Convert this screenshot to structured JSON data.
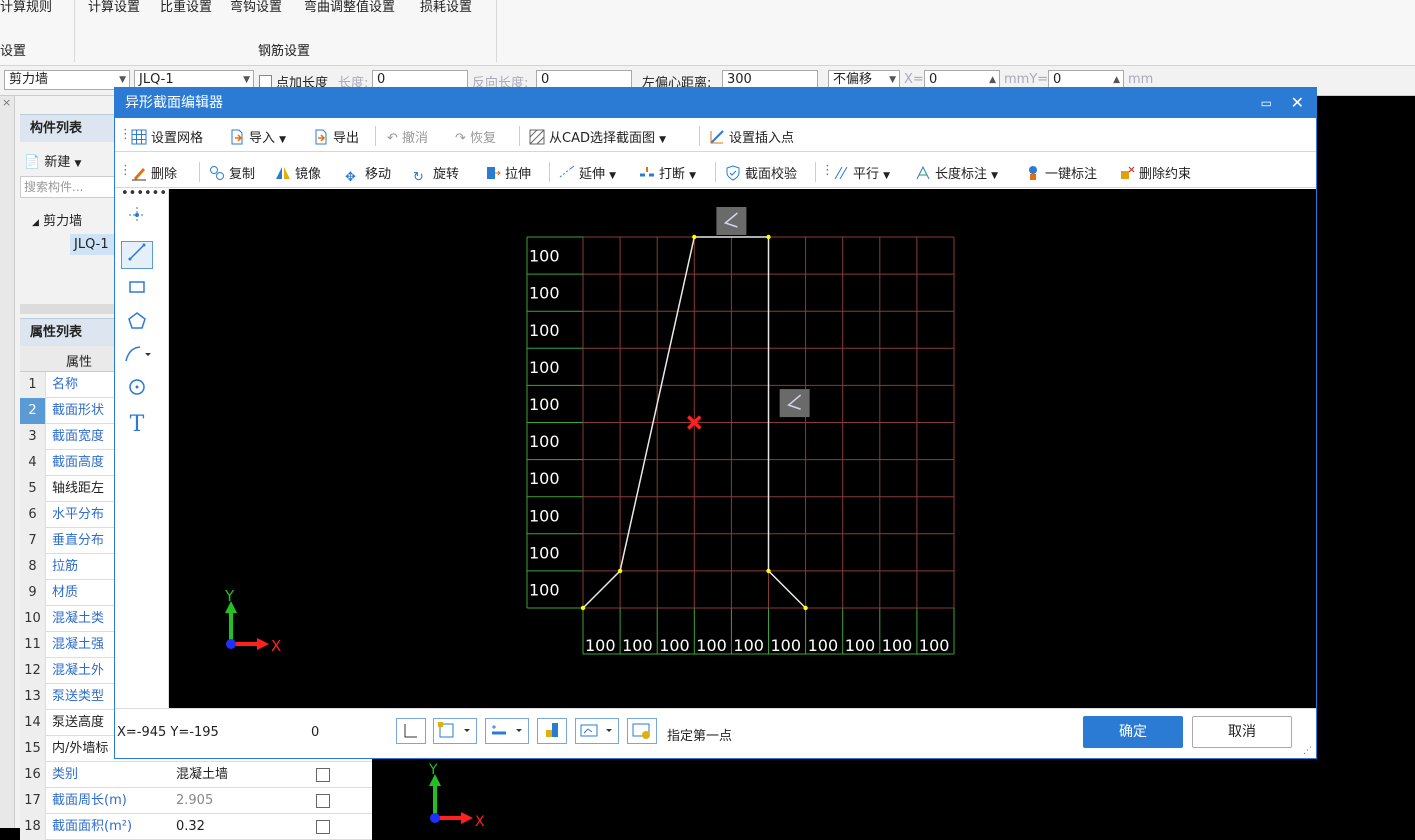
{
  "ribbon": {
    "calc_rules": "计算规则",
    "menu_items": [
      "计算设置",
      "比重设置",
      "弯钩设置",
      "弯曲调整值设置",
      "损耗设置"
    ],
    "group_left": "设置",
    "group_rebar": "钢筋设置"
  },
  "propbar": {
    "type_combo": "剪力墙",
    "name_combo": "JLQ-1",
    "add_length_label": "点加长度",
    "length_label": "长度:",
    "length_value": "0",
    "reverse_length_label": "反向长度:",
    "reverse_length_value": "0",
    "left_offset_label": "左偏心距离:",
    "left_offset_value": "300",
    "offset_mode": "不偏移",
    "x_label": "X=",
    "x_value": "0",
    "mm_y_label": "mmY=",
    "y_value": "0",
    "unit": "mm"
  },
  "leftpanel": {
    "component_list_title": "构件列表",
    "new_button": "新建",
    "search_placeholder": "搜索构件...",
    "tree_parent": "剪力墙",
    "tree_child": "JLQ-1",
    "property_list_title": "属性列表",
    "property_col_header": "属性",
    "rows": [
      {
        "num": "1",
        "name": "名称",
        "value": "",
        "blue": true
      },
      {
        "num": "2",
        "name": "截面形状",
        "value": "",
        "blue": true
      },
      {
        "num": "3",
        "name": "截面宽度",
        "value": "",
        "blue": true
      },
      {
        "num": "4",
        "name": "截面高度",
        "value": "",
        "blue": true
      },
      {
        "num": "5",
        "name": "轴线距左",
        "value": "",
        "blue": false
      },
      {
        "num": "6",
        "name": "水平分布",
        "value": "",
        "blue": true
      },
      {
        "num": "7",
        "name": "垂直分布",
        "value": "",
        "blue": true
      },
      {
        "num": "8",
        "name": "拉筋",
        "value": "",
        "blue": true
      },
      {
        "num": "9",
        "name": "材质",
        "value": "",
        "blue": true
      },
      {
        "num": "10",
        "name": "混凝土类",
        "value": "",
        "blue": true
      },
      {
        "num": "11",
        "name": "混凝土强",
        "value": "",
        "blue": true
      },
      {
        "num": "12",
        "name": "混凝土外",
        "value": "",
        "blue": true
      },
      {
        "num": "13",
        "name": "泵送类型",
        "value": "",
        "blue": true
      },
      {
        "num": "14",
        "name": "泵送高度",
        "value": "",
        "blue": false
      },
      {
        "num": "15",
        "name": "内/外墙标",
        "value": "",
        "blue": false
      },
      {
        "num": "16",
        "name": "类别",
        "value": "混凝土墙",
        "blue": true
      },
      {
        "num": "17",
        "name": "截面周长(m)",
        "value": "2.905",
        "blue": true
      },
      {
        "num": "18",
        "name": "截面面积(m²)",
        "value": "0.32",
        "blue": true
      }
    ]
  },
  "dialog": {
    "title": "异形截面编辑器",
    "toolbar1": {
      "set_grid": "设置网格",
      "import": "导入",
      "export": "导出",
      "undo": "撤消",
      "redo": "恢复",
      "from_cad": "从CAD选择截面图",
      "set_insert": "设置插入点"
    },
    "toolbar2": {
      "delete": "删除",
      "copy": "复制",
      "mirror": "镜像",
      "move": "移动",
      "rotate": "旋转",
      "stretch": "拉伸",
      "extend": "延伸",
      "break": "打断",
      "check": "截面校验",
      "parallel": "平行",
      "length_dim": "长度标注",
      "auto_dim": "一键标注",
      "delete_constraint": "删除约束"
    },
    "text_tool": "T",
    "grid": {
      "row_labels": [
        "100",
        "100",
        "100",
        "100",
        "100",
        "100",
        "100",
        "100",
        "100",
        "100"
      ],
      "col_labels": [
        "100",
        "100",
        "100",
        "100",
        "100",
        "100",
        "100",
        "100",
        "100",
        "100"
      ]
    },
    "axis": {
      "x": "X",
      "y": "Y"
    },
    "status": {
      "coords": "X=-945 Y=-195",
      "angle": "0",
      "hint": "指定第一点"
    },
    "ok_button": "确定",
    "cancel_button": "取消"
  },
  "colors": {
    "accent": "#2b7bd5",
    "grid_line": "#8b3a3a",
    "grid_axis": "#3aa53a",
    "shape": "#e8e8e8",
    "vertex": "#ffff00",
    "marker": "#ff2020"
  }
}
